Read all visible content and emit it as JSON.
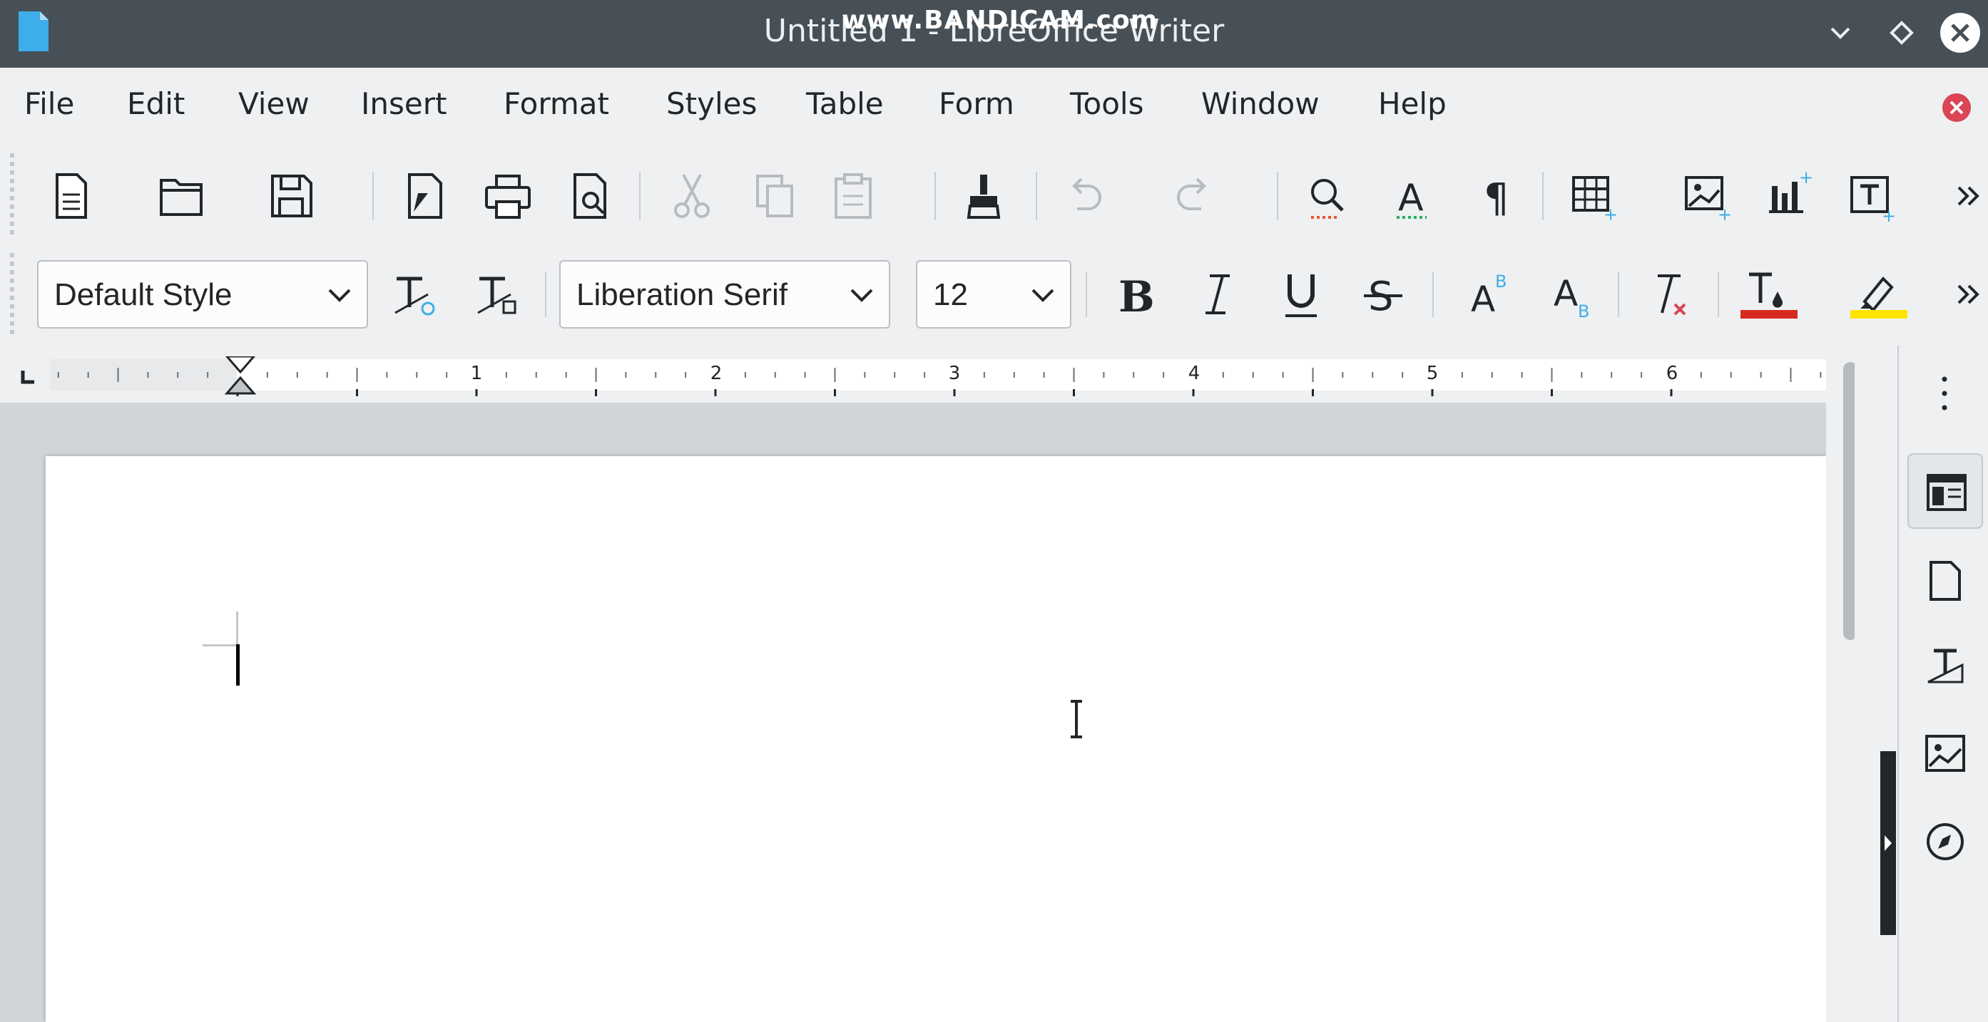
{
  "window": {
    "title": "Untitled 1 - LibreOffice Writer",
    "watermark": "www.BANDICAM.com"
  },
  "menubar": {
    "items": [
      "File",
      "Edit",
      "View",
      "Insert",
      "Format",
      "Styles",
      "Table",
      "Form",
      "Tools",
      "Window",
      "Help"
    ]
  },
  "formatting": {
    "paragraph_style": "Default Style",
    "font_name": "Liberation Serif",
    "font_size": "12"
  },
  "ruler": {
    "labels": [
      "1",
      "2",
      "3",
      "4",
      "5",
      "6"
    ]
  },
  "colors": {
    "font_color": "#d62a1e",
    "highlight_color": "#ffe400",
    "titlebar": "#475057",
    "accent_blue": "#3daee9",
    "close_red": "#da4453"
  },
  "icons": {
    "standard_toolbar": [
      "new-document-icon",
      "open-icon",
      "save-icon",
      "export-pdf-icon",
      "print-icon",
      "print-preview-icon",
      "cut-icon",
      "copy-icon",
      "paste-icon",
      "clone-formatting-icon",
      "undo-icon",
      "redo-icon",
      "find-replace-icon",
      "spelling-icon",
      "formatting-marks-icon",
      "insert-table-icon",
      "insert-image-icon",
      "insert-chart-icon",
      "insert-textbox-icon"
    ],
    "sidebar": [
      "properties-icon",
      "page-icon",
      "styles-icon",
      "gallery-icon",
      "navigator-icon"
    ]
  }
}
